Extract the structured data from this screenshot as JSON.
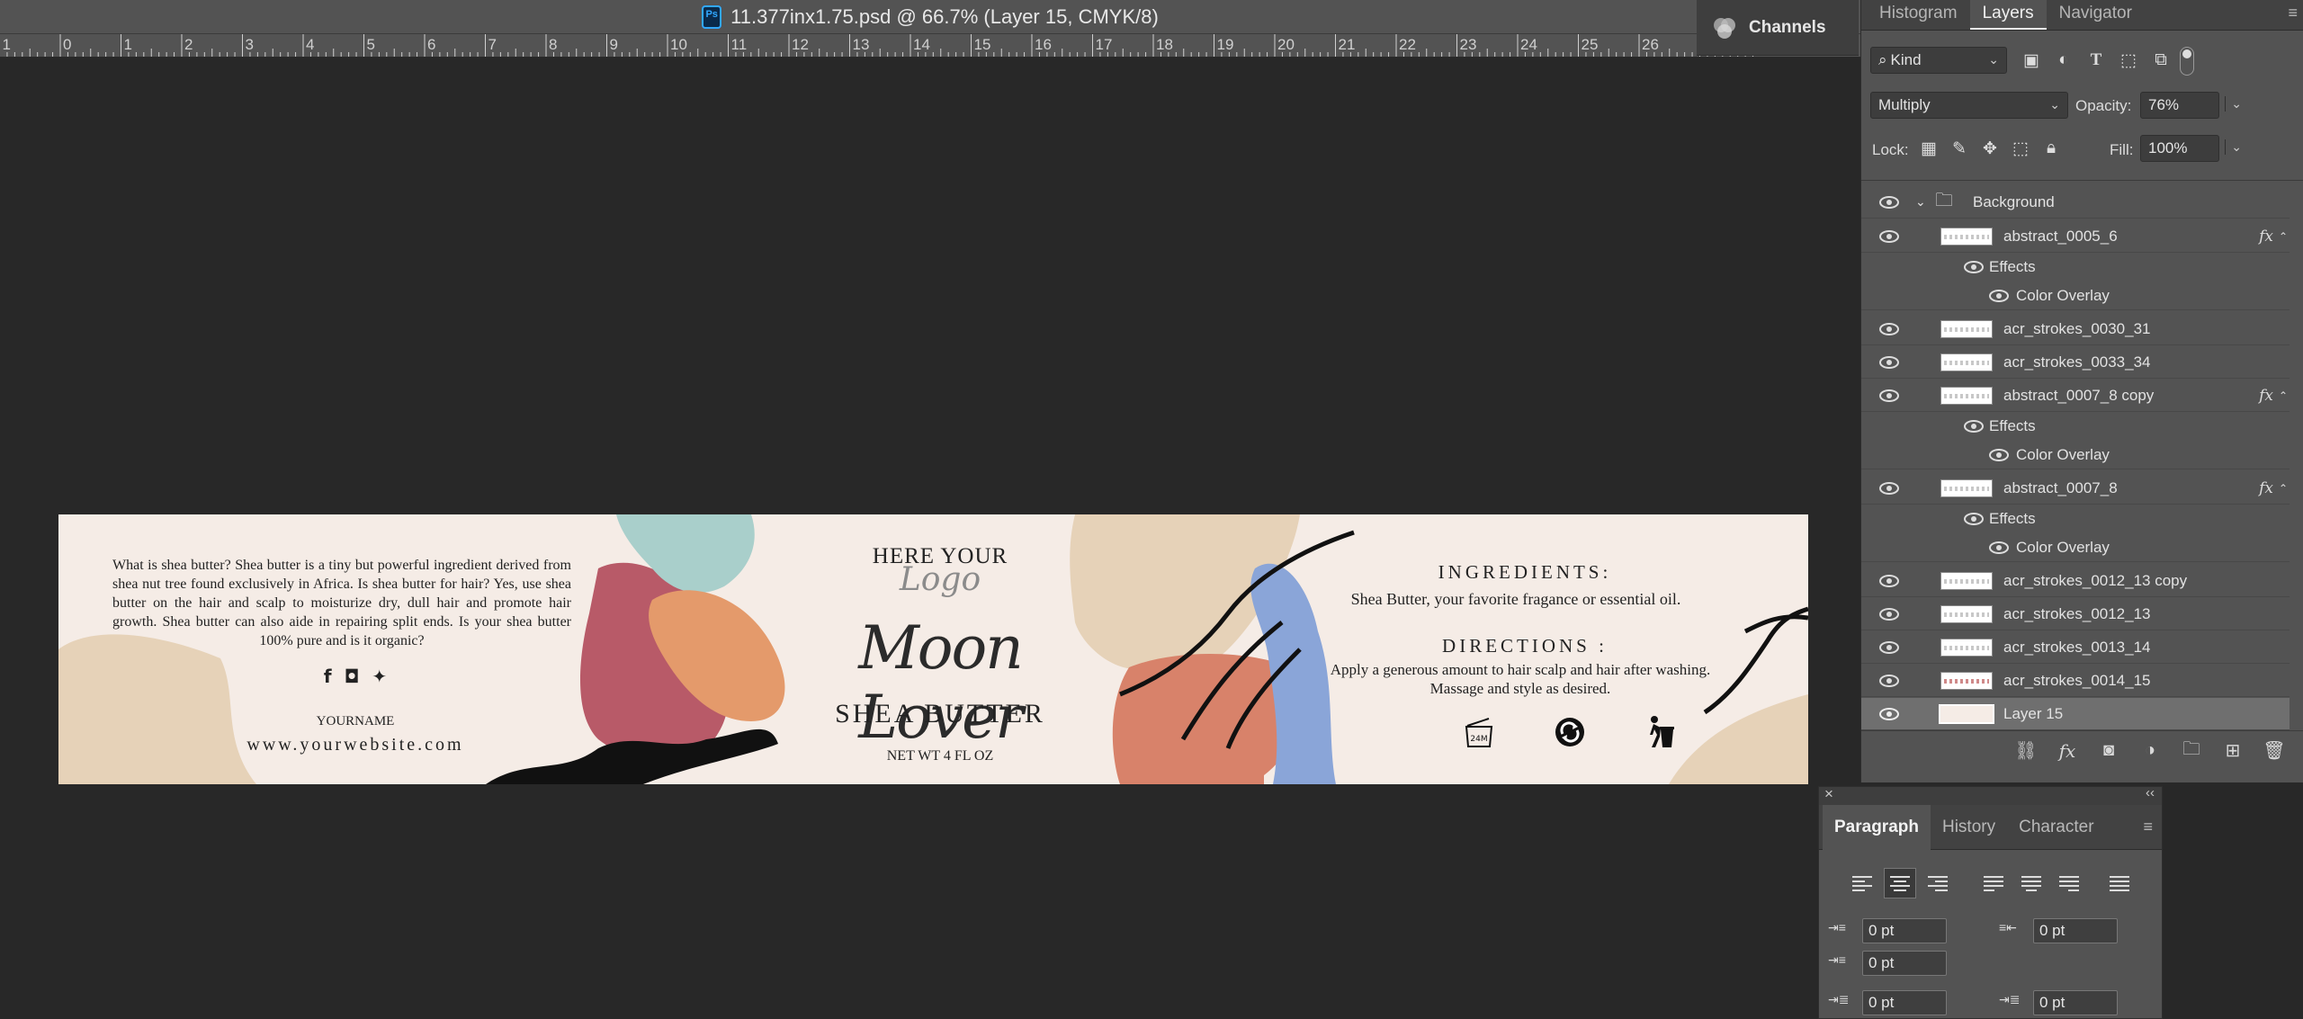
{
  "document": {
    "title": "11.377inx1.75.psd @ 66.7% (Layer 15, CMYK/8)",
    "app_icon": "photoshop-icon"
  },
  "ruler": {
    "numbers": [
      "1",
      "0",
      "1",
      "2",
      "3",
      "4",
      "5",
      "6",
      "7",
      "8",
      "9",
      "10",
      "11",
      "12",
      "13",
      "14",
      "15",
      "16",
      "17",
      "18",
      "19",
      "20",
      "21",
      "22",
      "23",
      "24",
      "25",
      "26"
    ]
  },
  "label": {
    "description": "What is shea butter? Shea butter is a tiny but powerful ingredient derived from shea nut tree found exclusively in Africa. Is shea butter for hair? Yes, use shea butter on the hair and scalp to moisturize dry, dull hair and promote hair growth. Shea butter can also aide in repairing split ends. Is your shea butter 100% pure and is it organic?",
    "social_icons": [
      "facebook-icon",
      "instagram-icon",
      "twitter-icon"
    ],
    "yourname": "YOURNAME",
    "website": "www.yourwebsite.com",
    "here_your": "HERE YOUR",
    "logo": "Logo",
    "brand": "Moon Lover",
    "product": "SHEA BUTTER",
    "net_wt": "NET WT 4 FL OZ",
    "ingredients_heading": "INGREDIENTS:",
    "ingredients_text": "Shea Butter, your favorite fragance  or essential oil.",
    "directions_heading": "DIRECTIONS :",
    "directions_text": "Apply a generous amount to hair scalp and hair after washing. Massage and style as desired.",
    "symbol_24m": "24M",
    "symbols": [
      "period-after-opening-icon",
      "recycle-icon",
      "tidyman-bin-icon"
    ]
  },
  "channels_tab": {
    "label": "Channels"
  },
  "layers_panel": {
    "tabs": [
      "Histogram",
      "Layers",
      "Navigator"
    ],
    "active_tab": "Layers",
    "filter_kind": "Kind",
    "blend_mode": "Multiply",
    "opacity_label": "Opacity:",
    "opacity_value": "76%",
    "lock_label": "Lock:",
    "fill_label": "Fill:",
    "fill_value": "100%",
    "group_name": "Background",
    "layers": [
      {
        "name": "abstract_0005_6",
        "fx": "fx"
      },
      {
        "name": "Effects"
      },
      {
        "name": "Color Overlay"
      },
      {
        "name": "acr_strokes_0030_31"
      },
      {
        "name": "acr_strokes_0033_34"
      },
      {
        "name": "abstract_0007_8 copy",
        "fx": "fx"
      },
      {
        "name": "Effects"
      },
      {
        "name": "Color Overlay"
      },
      {
        "name": "abstract_0007_8",
        "fx": "fx"
      },
      {
        "name": "Effects"
      },
      {
        "name": "Color Overlay"
      },
      {
        "name": "acr_strokes_0012_13 copy"
      },
      {
        "name": "acr_strokes_0012_13"
      },
      {
        "name": "acr_strokes_0013_14"
      },
      {
        "name": "acr_strokes_0014_15"
      },
      {
        "name": "Layer 15"
      }
    ],
    "footer_icons": [
      "link-layers-icon",
      "fx-icon",
      "layer-mask-icon",
      "adjustment-layer-icon",
      "new-group-icon",
      "new-layer-icon",
      "delete-layer-icon"
    ]
  },
  "paragraph_panel": {
    "tabs": [
      "Paragraph",
      "History",
      "Character"
    ],
    "active_tab": "Paragraph",
    "indent_left": "0 pt",
    "indent_right": "0 pt",
    "indent_first": "0 pt",
    "space_before": "0 pt",
    "space_after": "0 pt"
  },
  "colors": {
    "canvas_bg": "#282828",
    "panel_bg": "#535353",
    "label_bg": "#f5ece6",
    "paint_teal": "#a9cfcb",
    "paint_rose": "#b85a68",
    "paint_peach": "#e49a6b",
    "paint_beige": "#e6d2b8",
    "paint_blue": "#8aa5d8",
    "paint_terracotta": "#d8826a"
  }
}
